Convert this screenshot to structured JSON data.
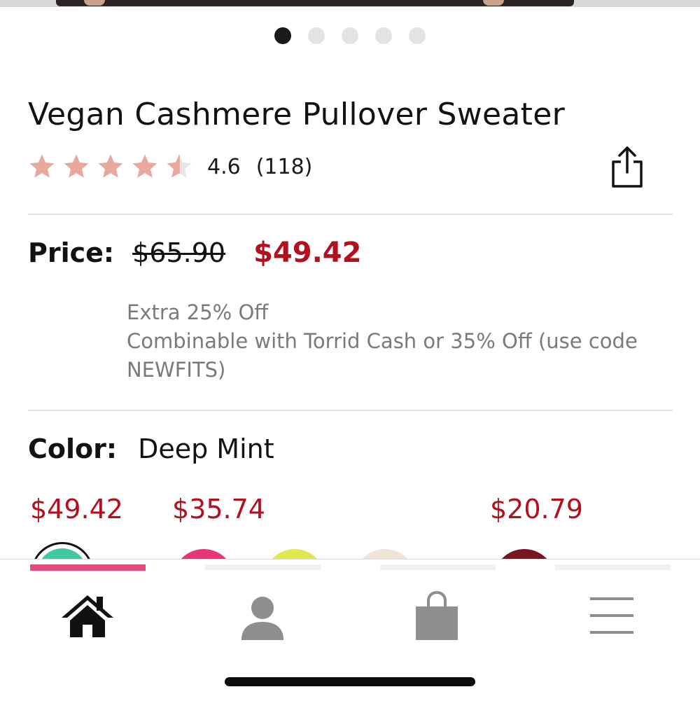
{
  "carousel": {
    "dot_count": 5,
    "active_index": 0
  },
  "product": {
    "title": "Vegan Cashmere Pullover Sweater",
    "rating": {
      "value": "4.6",
      "count": "(118)",
      "stars": 4.6,
      "max_stars": 5,
      "star_color": "#e9a89d"
    }
  },
  "price": {
    "label": "Price:",
    "original": "$65.90",
    "sale": "$49.42",
    "sale_color": "#b3101d"
  },
  "promo": {
    "line1": "Extra 25% Off",
    "line2": "Combinable with Torrid Cash or 35% Off (use code",
    "line3": "NEWFITS)"
  },
  "color": {
    "label": "Color:",
    "selected": "Deep Mint",
    "swatch_prices": [
      "$49.42",
      "$35.74",
      "$20.79"
    ],
    "swatches": [
      {
        "name": "Deep Mint",
        "hex": "#3fc9a0"
      },
      {
        "name": "pink",
        "hex": "#e8357a"
      },
      {
        "name": "lime",
        "hex": "#dfe94f"
      },
      {
        "name": "cream",
        "hex": "#efe4d6"
      },
      {
        "name": "burgundy",
        "hex": "#7a1420"
      }
    ]
  },
  "tabbar": {
    "accent": "#e04b7c",
    "items": [
      {
        "name": "home",
        "icon": "home-icon",
        "active": true
      },
      {
        "name": "account",
        "icon": "user-icon",
        "active": false
      },
      {
        "name": "bag",
        "icon": "shopping-bag-icon",
        "active": false
      },
      {
        "name": "menu",
        "icon": "hamburger-menu-icon",
        "active": false
      }
    ]
  },
  "icons": {
    "share": "share-icon"
  }
}
